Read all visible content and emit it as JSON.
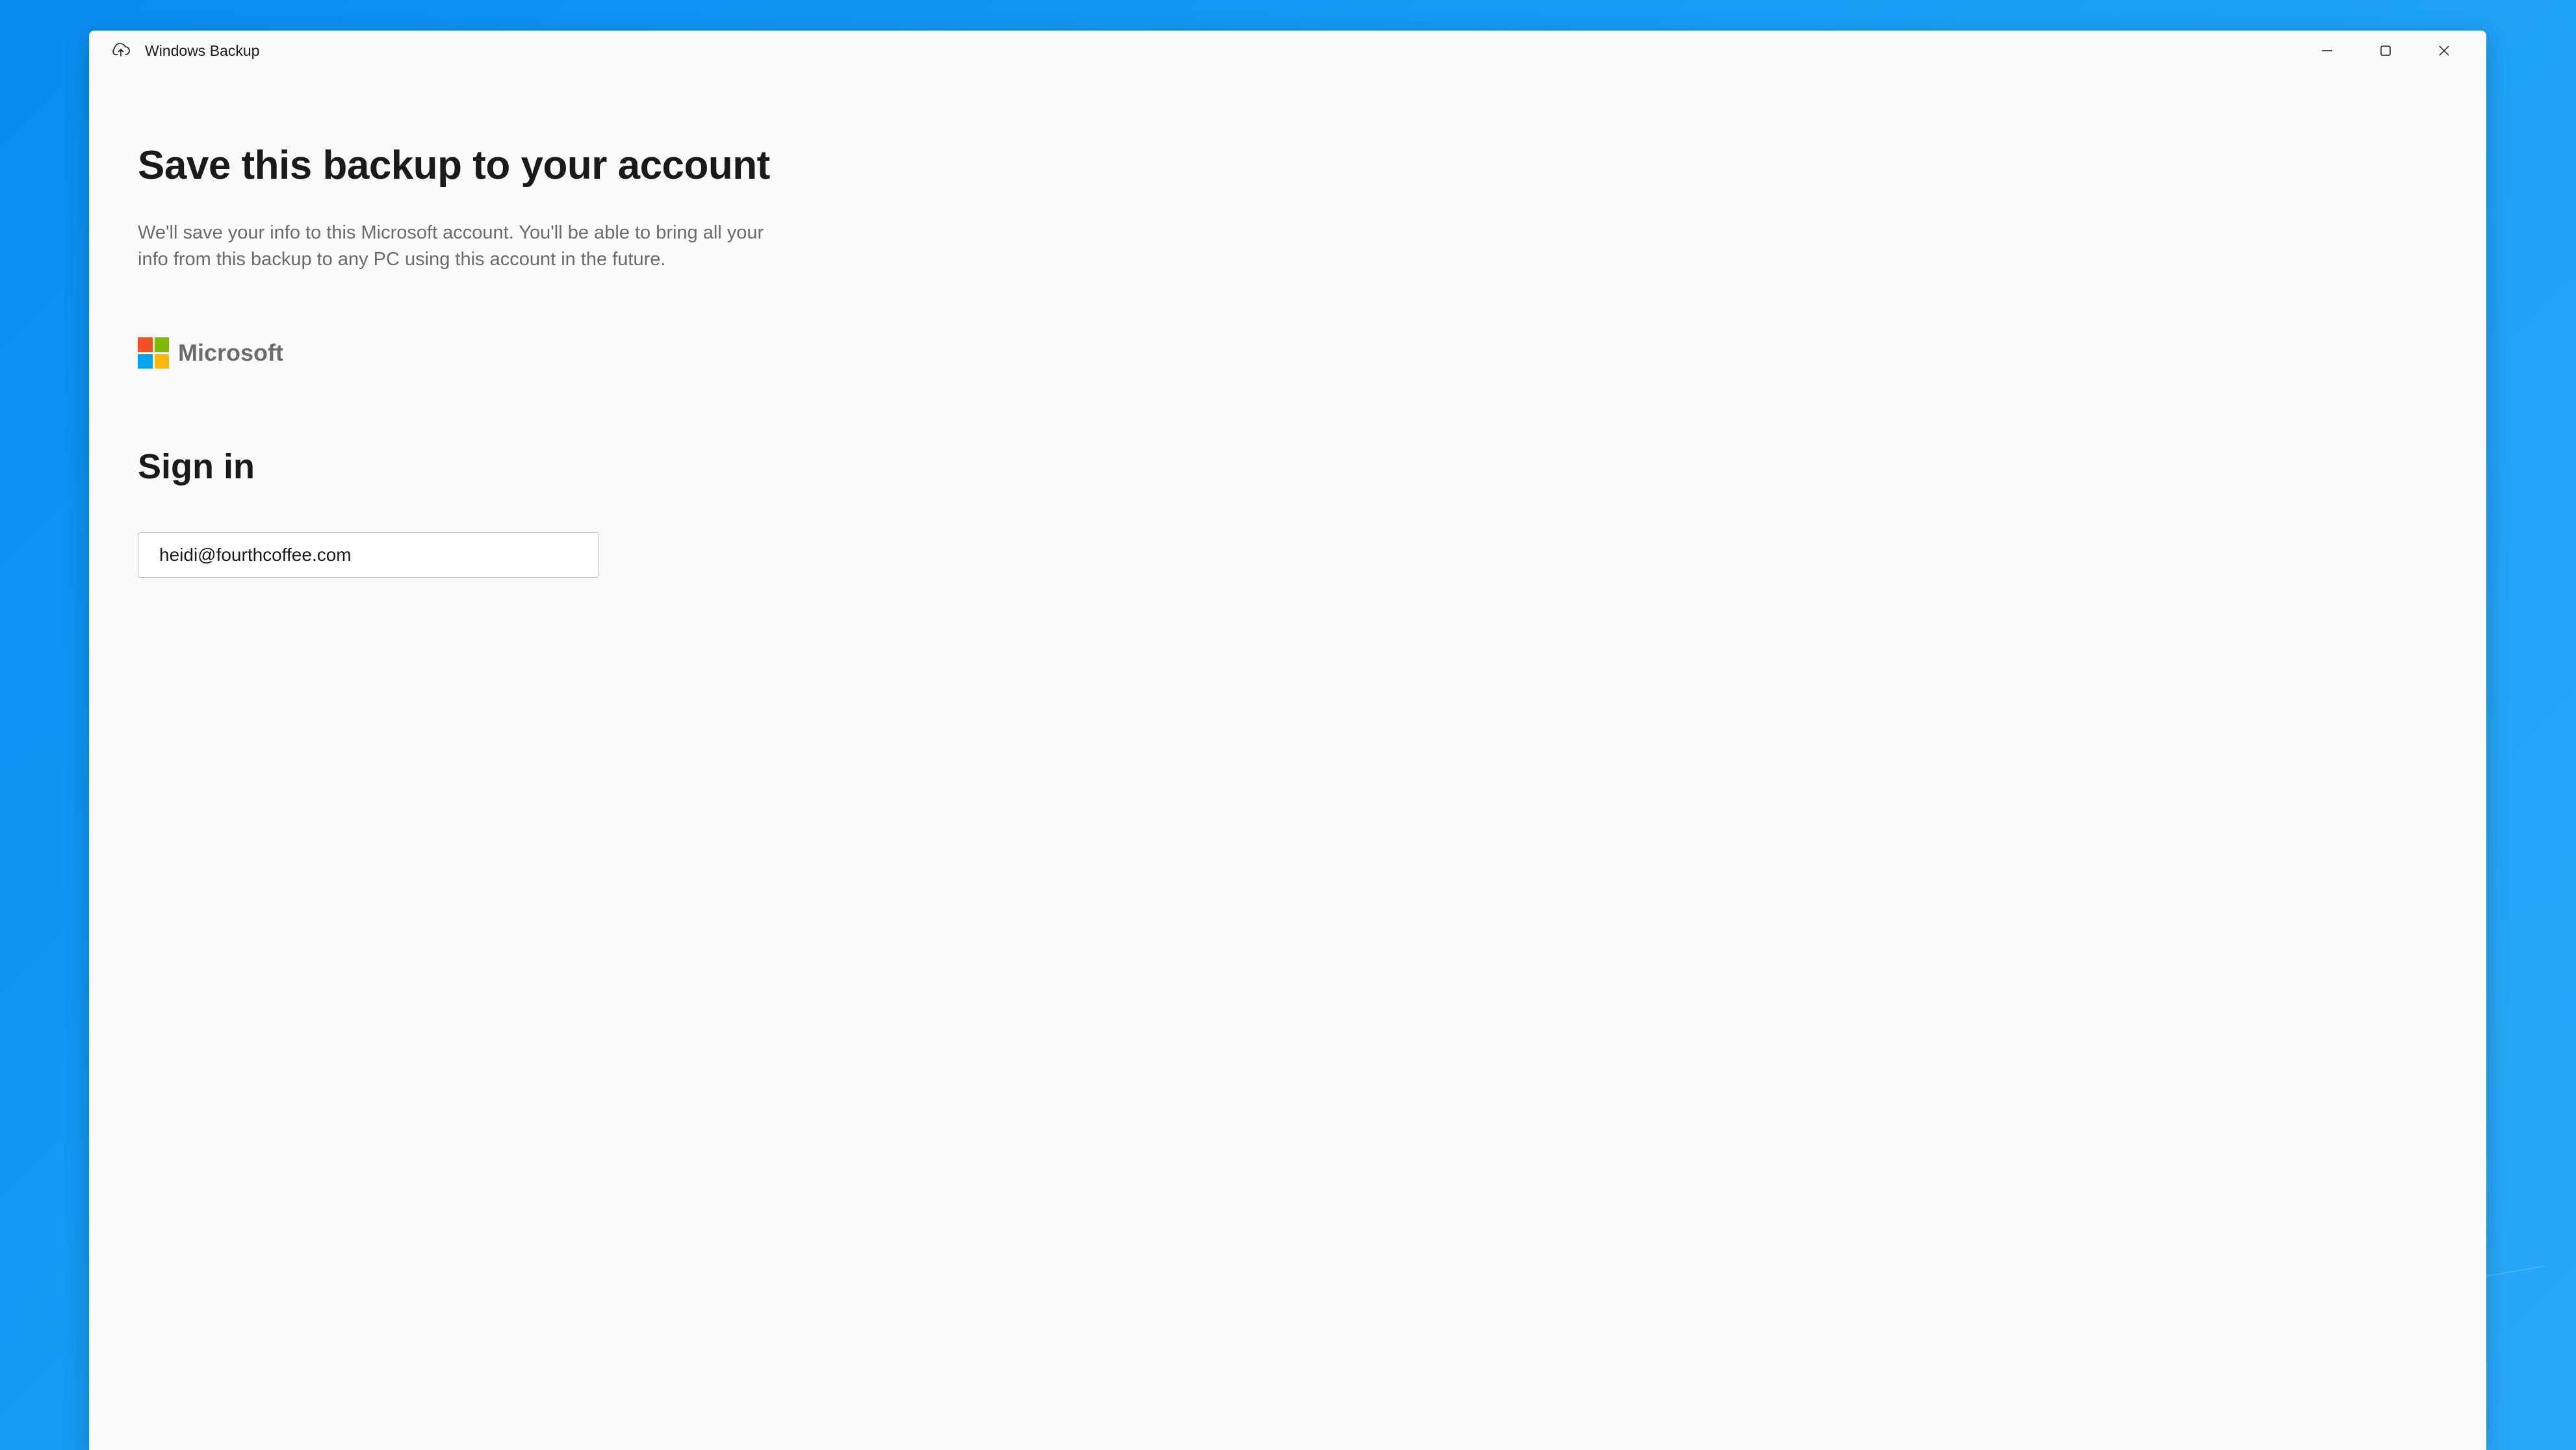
{
  "window": {
    "app_title": "Windows Backup",
    "app_icon": "cloud-upload-icon"
  },
  "main": {
    "heading": "Save this backup to your account",
    "description": "We'll save your info to this Microsoft account. You'll be able to bring all your info from this backup to any PC using this account in the future.",
    "brand_label": "Microsoft",
    "signin_heading": "Sign in",
    "email_value": "heidi@fourthcoffee.com"
  },
  "colors": {
    "ms_red": "#f25022",
    "ms_green": "#7fba00",
    "ms_blue": "#00a4ef",
    "ms_yellow": "#ffb900",
    "desktop_bg": "#1a9ff5"
  }
}
